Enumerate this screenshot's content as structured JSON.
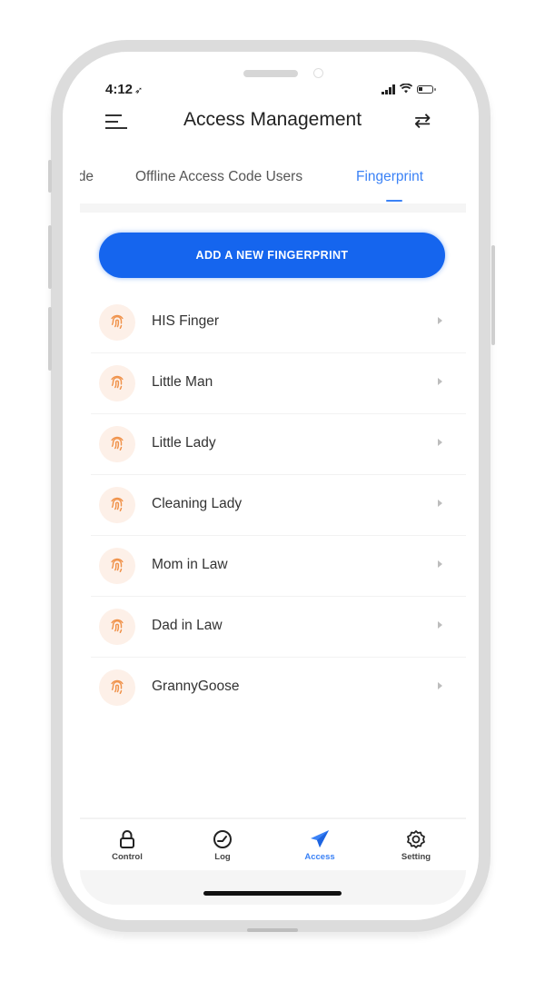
{
  "status_bar": {
    "time": "4:12",
    "location_icon": "location-arrow-icon",
    "icons": [
      "signal-icon",
      "wifi-icon",
      "battery-icon"
    ]
  },
  "header": {
    "title": "Access Management",
    "menu_icon": "hamburger-menu-icon",
    "switch_icon": "swap-arrows-icon"
  },
  "tabs": [
    {
      "label": "Code",
      "partial": true,
      "active": false
    },
    {
      "label": "Offline Access Code Users",
      "active": false
    },
    {
      "label": "Fingerprint",
      "active": true
    }
  ],
  "add_button": {
    "label": "ADD A NEW FINGERPRINT"
  },
  "fingerprints": [
    {
      "name": "HIS Finger",
      "icon": "fingerprint-icon"
    },
    {
      "name": "Little Man",
      "icon": "fingerprint-icon"
    },
    {
      "name": "Little Lady",
      "icon": "fingerprint-icon"
    },
    {
      "name": "Cleaning Lady",
      "icon": "fingerprint-icon"
    },
    {
      "name": "Mom in Law",
      "icon": "fingerprint-icon"
    },
    {
      "name": "Dad in Law",
      "icon": "fingerprint-icon"
    },
    {
      "name": "GrannyGoose",
      "icon": "fingerprint-icon"
    }
  ],
  "bottom_nav": [
    {
      "label": "Control",
      "icon": "lock-icon",
      "active": false
    },
    {
      "label": "Log",
      "icon": "clock-icon",
      "active": false
    },
    {
      "label": "Access",
      "icon": "paper-plane-icon",
      "active": true
    },
    {
      "label": "Setting",
      "icon": "gear-icon",
      "active": false
    }
  ],
  "colors": {
    "accent": "#3b82f6",
    "button": "#1565ee",
    "fingerprint_icon": "#f0924a",
    "fingerprint_bg": "#fdf0e8"
  }
}
